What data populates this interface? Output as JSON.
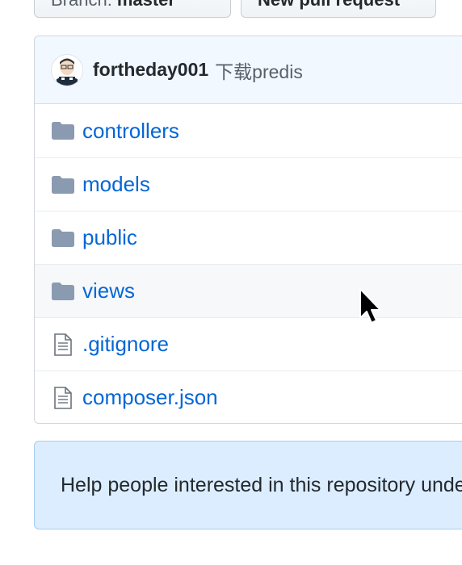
{
  "toolbar": {
    "branch_prefix": "Branch:",
    "branch_name": "master",
    "new_pr_label": "New pull request"
  },
  "commit": {
    "author": "fortheday001",
    "message": "下载predis"
  },
  "files": [
    {
      "name": "controllers",
      "type": "folder",
      "icon": "folder-icon"
    },
    {
      "name": "models",
      "type": "folder",
      "icon": "folder-icon"
    },
    {
      "name": "public",
      "type": "folder",
      "icon": "folder-icon"
    },
    {
      "name": "views",
      "type": "folder",
      "icon": "folder-icon",
      "hovered": true
    },
    {
      "name": ".gitignore",
      "type": "file",
      "icon": "file-icon"
    },
    {
      "name": "composer.json",
      "type": "file",
      "icon": "file-icon"
    }
  ],
  "help_banner": {
    "text": "Help people interested in this repository understand your project by adding a README."
  },
  "colors": {
    "link": "#0366d6",
    "folder_icon": "#79b8ff",
    "header_bg": "#f1f8ff",
    "help_bg": "#dbedff"
  }
}
